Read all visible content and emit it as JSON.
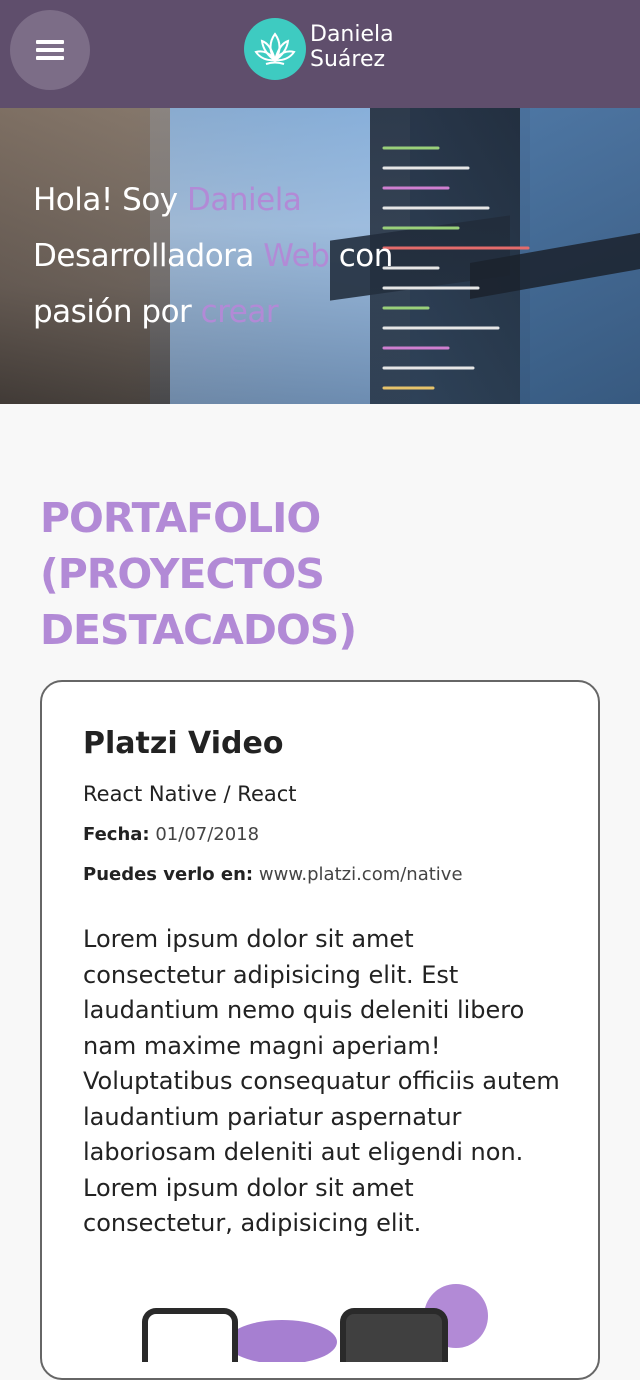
{
  "header": {
    "menu_icon": "hamburger-menu-icon",
    "logo_icon": "lotus-icon",
    "logo_line1": "Daniela",
    "logo_line2": "Suárez",
    "colors": {
      "background": "#5f4e6c",
      "logo": "#3ecbc1"
    }
  },
  "hero": {
    "line1_a": "Hola! Soy ",
    "line1_b": "Daniela",
    "line2_a": "Desarrolladora ",
    "line2_b": "Web",
    "line2_c": " con",
    "line3_a": "pasión por ",
    "line3_b": "crear",
    "accent_color": "#b28ad6"
  },
  "portfolio": {
    "title": "PORTAFOLIO (PROYECTOS DESTACADOS)",
    "project": {
      "title": "Platzi Video",
      "tech": "React Native / React",
      "date_label": "Fecha:",
      "date_value": "01/07/2018",
      "link_label": "Puedes verlo en:",
      "link_value": "www.platzi.com/native",
      "description": "Lorem ipsum dolor sit amet consectetur adipisicing elit. Est laudantium nemo quis deleniti libero nam maxime magni aperiam! Voluptatibus consequatur officiis autem laudantium pariatur aspernatur laboriosam deleniti aut eligendi non. Lorem ipsum dolor sit amet consectetur, adipisicing elit."
    }
  }
}
